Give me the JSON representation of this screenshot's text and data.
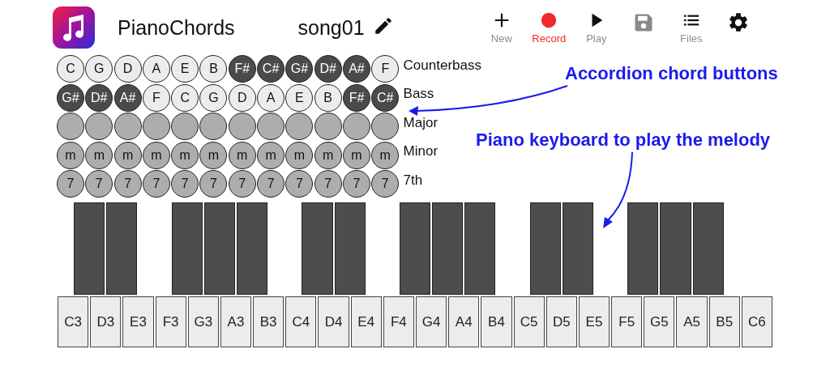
{
  "app": {
    "title": "PianoChords"
  },
  "song": {
    "name": "song01"
  },
  "toolbar": [
    {
      "kind": "new",
      "label": "New"
    },
    {
      "kind": "record",
      "label": "Record"
    },
    {
      "kind": "play",
      "label": "Play"
    },
    {
      "kind": "save",
      "disabled": true
    },
    {
      "kind": "files",
      "label": "Files"
    },
    {
      "kind": "settings"
    }
  ],
  "accordion_rows": [
    {
      "label": "Counterbass",
      "kind": "note",
      "buttons": [
        {
          "text": "C",
          "dark": false
        },
        {
          "text": "G",
          "dark": false
        },
        {
          "text": "D",
          "dark": false
        },
        {
          "text": "A",
          "dark": false
        },
        {
          "text": "E",
          "dark": false
        },
        {
          "text": "B",
          "dark": false
        },
        {
          "text": "F#",
          "dark": true
        },
        {
          "text": "C#",
          "dark": true
        },
        {
          "text": "G#",
          "dark": true
        },
        {
          "text": "D#",
          "dark": true
        },
        {
          "text": "A#",
          "dark": true
        },
        {
          "text": "F",
          "dark": false
        }
      ]
    },
    {
      "label": "Bass",
      "kind": "note",
      "buttons": [
        {
          "text": "G#",
          "dark": true
        },
        {
          "text": "D#",
          "dark": true
        },
        {
          "text": "A#",
          "dark": true
        },
        {
          "text": "F",
          "dark": false
        },
        {
          "text": "C",
          "dark": false
        },
        {
          "text": "G",
          "dark": false
        },
        {
          "text": "D",
          "dark": false
        },
        {
          "text": "A",
          "dark": false
        },
        {
          "text": "E",
          "dark": false
        },
        {
          "text": "B",
          "dark": false
        },
        {
          "text": "F#",
          "dark": true
        },
        {
          "text": "C#",
          "dark": true
        }
      ]
    },
    {
      "label": "Major",
      "kind": "chord",
      "buttons": [
        {
          "dark": false
        },
        {
          "dark": false
        },
        {
          "dark": false
        },
        {
          "dark": false
        },
        {
          "dark": false
        },
        {
          "dark": false
        },
        {
          "dark": false
        },
        {
          "dark": false
        },
        {
          "dark": false
        },
        {
          "dark": false
        },
        {
          "dark": false
        },
        {
          "dark": false
        }
      ]
    },
    {
      "label": "Minor",
      "kind": "chord",
      "buttons": [
        {
          "text": "m",
          "dark": false
        },
        {
          "text": "m",
          "dark": false
        },
        {
          "text": "m",
          "dark": false
        },
        {
          "text": "m",
          "dark": false
        },
        {
          "text": "m",
          "dark": false
        },
        {
          "text": "m",
          "dark": false
        },
        {
          "text": "m",
          "dark": false
        },
        {
          "text": "m",
          "dark": false
        },
        {
          "text": "m",
          "dark": false
        },
        {
          "text": "m",
          "dark": false
        },
        {
          "text": "m",
          "dark": false
        },
        {
          "text": "m",
          "dark": false
        }
      ]
    },
    {
      "label": "7th",
      "kind": "chord",
      "buttons": [
        {
          "text": "7",
          "dark": false
        },
        {
          "text": "7",
          "dark": false
        },
        {
          "text": "7",
          "dark": false
        },
        {
          "text": "7",
          "dark": false
        },
        {
          "text": "7",
          "dark": false
        },
        {
          "text": "7",
          "dark": false
        },
        {
          "text": "7",
          "dark": false
        },
        {
          "text": "7",
          "dark": false
        },
        {
          "text": "7",
          "dark": false
        },
        {
          "text": "7",
          "dark": false
        },
        {
          "text": "7",
          "dark": false
        },
        {
          "text": "7",
          "dark": false
        }
      ]
    }
  ],
  "piano_keys": [
    {
      "label": "C3",
      "sharp": true
    },
    {
      "label": "D3",
      "sharp": true
    },
    {
      "label": "E3",
      "sharp": false
    },
    {
      "label": "F3",
      "sharp": true
    },
    {
      "label": "G3",
      "sharp": true
    },
    {
      "label": "A3",
      "sharp": true
    },
    {
      "label": "B3",
      "sharp": false
    },
    {
      "label": "C4",
      "sharp": true
    },
    {
      "label": "D4",
      "sharp": true
    },
    {
      "label": "E4",
      "sharp": false
    },
    {
      "label": "F4",
      "sharp": true
    },
    {
      "label": "G4",
      "sharp": true
    },
    {
      "label": "A4",
      "sharp": true
    },
    {
      "label": "B4",
      "sharp": false
    },
    {
      "label": "C5",
      "sharp": true
    },
    {
      "label": "D5",
      "sharp": true
    },
    {
      "label": "E5",
      "sharp": false
    },
    {
      "label": "F5",
      "sharp": true
    },
    {
      "label": "G5",
      "sharp": true
    },
    {
      "label": "A5",
      "sharp": true
    },
    {
      "label": "B5",
      "sharp": false
    },
    {
      "label": "C6",
      "sharp": false
    }
  ],
  "annotations": [
    {
      "text": "Accordion chord buttons"
    },
    {
      "text": "Piano keyboard to play the melody"
    }
  ]
}
